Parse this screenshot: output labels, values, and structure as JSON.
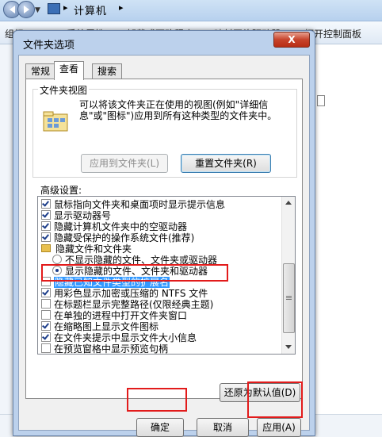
{
  "explorer": {
    "address": "计算机",
    "toolbar": [
      "组织 ▾",
      "系统属性",
      "卸载或更改程序",
      "映射网络驱动器",
      "打开控制面板"
    ]
  },
  "dialog": {
    "title": "文件夹选项",
    "close_label": "X",
    "tabs": [
      "常规",
      "查看",
      "搜索"
    ],
    "active_tab": "查看",
    "folder_views": {
      "title": "文件夹视图",
      "description": "可以将该文件夹正在使用的视图(例如\"详细信息\"或\"图标\")应用到所有这种类型的文件夹中。",
      "apply_button": "应用到文件夹(L)",
      "reset_button": "重置文件夹(R)"
    },
    "advanced": {
      "label": "高级设置:",
      "items": [
        {
          "type": "checkbox",
          "checked": true,
          "label": "鼠标指向文件夹和桌面项时显示提示信息"
        },
        {
          "type": "checkbox",
          "checked": true,
          "label": "显示驱动器号"
        },
        {
          "type": "checkbox",
          "checked": true,
          "label": "隐藏计算机文件夹中的空驱动器"
        },
        {
          "type": "checkbox",
          "checked": true,
          "label": "隐藏受保护的操作系统文件(推荐)"
        },
        {
          "type": "folder",
          "label": "隐藏文件和文件夹"
        },
        {
          "type": "radio",
          "checked": false,
          "label": "不显示隐藏的文件、文件夹或驱动器"
        },
        {
          "type": "radio",
          "checked": true,
          "label": "显示隐藏的文件、文件夹和驱动器"
        },
        {
          "type": "checkbox",
          "checked": false,
          "selected": true,
          "label": "隐藏已知文件类型的扩展名"
        },
        {
          "type": "checkbox",
          "checked": true,
          "label": "用彩色显示加密或压缩的 NTFS 文件"
        },
        {
          "type": "checkbox",
          "checked": false,
          "label": "在标题栏显示完整路径(仅限经典主题)"
        },
        {
          "type": "checkbox",
          "checked": false,
          "label": "在单独的进程中打开文件夹窗口"
        },
        {
          "type": "checkbox",
          "checked": true,
          "label": "在缩略图上显示文件图标"
        },
        {
          "type": "checkbox",
          "checked": true,
          "label": "在文件夹提示中显示文件大小信息"
        },
        {
          "type": "checkbox",
          "checked": false,
          "label": "在预览窗格中显示预览句柄"
        }
      ]
    },
    "restore_button": "还原为默认值(D)",
    "ok_button": "确定",
    "cancel_button": "取消",
    "apply_button": "应用(A)"
  },
  "colors": {
    "highlight": "#e21b1b",
    "selection": "#3399ff"
  }
}
